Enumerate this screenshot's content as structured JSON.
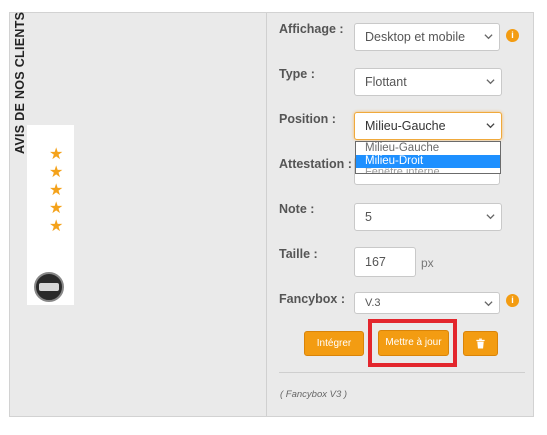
{
  "widget": {
    "text": "AVIS DE NOS CLIENTS",
    "stars": 5,
    "star_color": "#f4a21b",
    "logo_text": "Reviews"
  },
  "form": {
    "affichage": {
      "label": "Affichage :",
      "value": "Desktop et mobile"
    },
    "type": {
      "label": "Type :",
      "value": "Flottant"
    },
    "position": {
      "label": "Position :",
      "value": "Milieu-Gauche",
      "options": [
        "Milieu-Gauche",
        "Milieu-Droit"
      ],
      "highlighted_option": "Milieu-Droit"
    },
    "attestation": {
      "label": "Attestation :",
      "value": "Fenêtre interne"
    },
    "note": {
      "label": "Note :",
      "value": "5"
    },
    "taille": {
      "label": "Taille :",
      "value": "167",
      "unit": "px"
    },
    "fancybox": {
      "label": "Fancybox :",
      "value": "V.3"
    }
  },
  "buttons": {
    "integrer": "Intégrer",
    "mettre_a_jour": "Mettre à jour",
    "delete_icon": "trash-icon"
  },
  "footer": "( Fancybox V3 )",
  "colors": {
    "accent": "#f39c12",
    "highlight_border": "#e3262d",
    "selected_option": "#1e90ff"
  }
}
